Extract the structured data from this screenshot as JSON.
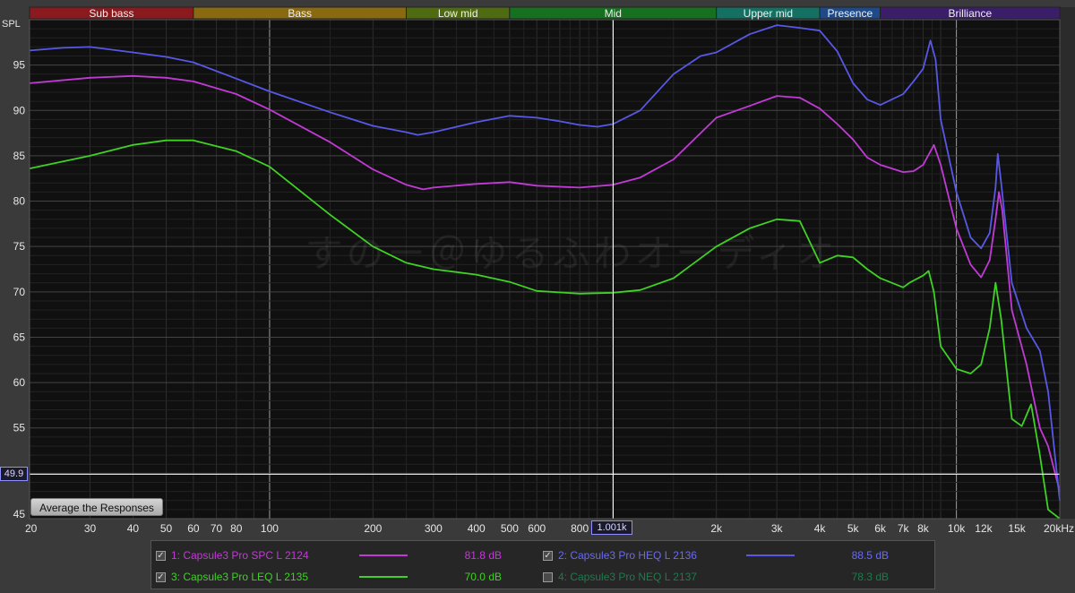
{
  "bands": [
    {
      "label": "Sub bass",
      "from": 20,
      "to": 60,
      "color": "#8a1a1e"
    },
    {
      "label": "Bass",
      "from": 60,
      "to": 250,
      "color": "#8a6a10"
    },
    {
      "label": "Low mid",
      "from": 250,
      "to": 500,
      "color": "#4f6b12"
    },
    {
      "label": "Mid",
      "from": 500,
      "to": 2000,
      "color": "#15701f"
    },
    {
      "label": "Upper mid",
      "from": 2000,
      "to": 4000,
      "color": "#137062"
    },
    {
      "label": "Presence",
      "from": 4000,
      "to": 6000,
      "color": "#1e4a8a"
    },
    {
      "label": "Brilliance",
      "from": 6000,
      "to": 20000,
      "color": "#3b1e6a"
    }
  ],
  "watermark": "すのー＠ゆるふわオーディオ",
  "avg_button_label": "Average the Responses",
  "cursor": {
    "y_readout": "49.9",
    "x_readout": "1.001k",
    "freq": 1001,
    "level": 49.9
  },
  "chart_data": {
    "type": "line",
    "ylabel": "SPL",
    "xlabel": "",
    "x_scale": "log",
    "xlim": [
      20,
      20000
    ],
    "ylim": [
      45,
      100
    ],
    "grid": true,
    "y_ticks": [
      {
        "v": 95,
        "label": "95"
      },
      {
        "v": 90,
        "label": "90"
      },
      {
        "v": 85,
        "label": "85"
      },
      {
        "v": 80,
        "label": "80"
      },
      {
        "v": 75,
        "label": "75"
      },
      {
        "v": 70,
        "label": "70"
      },
      {
        "v": 65,
        "label": "65"
      },
      {
        "v": 60,
        "label": "60"
      },
      {
        "v": 55,
        "label": "55"
      },
      {
        "v": 50,
        "label": "50"
      },
      {
        "v": 45,
        "label": "45"
      }
    ],
    "x_ticks": [
      {
        "v": 20,
        "label": "20"
      },
      {
        "v": 30,
        "label": "30"
      },
      {
        "v": 40,
        "label": "40"
      },
      {
        "v": 50,
        "label": "50"
      },
      {
        "v": 60,
        "label": "60"
      },
      {
        "v": 70,
        "label": "70"
      },
      {
        "v": 80,
        "label": "80"
      },
      {
        "v": 100,
        "label": "100"
      },
      {
        "v": 200,
        "label": "200"
      },
      {
        "v": 300,
        "label": "300"
      },
      {
        "v": 400,
        "label": "400"
      },
      {
        "v": 500,
        "label": "500"
      },
      {
        "v": 600,
        "label": "600"
      },
      {
        "v": 800,
        "label": "800"
      },
      {
        "v": 2000,
        "label": "2k"
      },
      {
        "v": 3000,
        "label": "3k"
      },
      {
        "v": 4000,
        "label": "4k"
      },
      {
        "v": 5000,
        "label": "5k"
      },
      {
        "v": 6000,
        "label": "6k"
      },
      {
        "v": 7000,
        "label": "7k"
      },
      {
        "v": 8000,
        "label": "8k"
      },
      {
        "v": 10000,
        "label": "10k"
      },
      {
        "v": 12000,
        "label": "12k"
      },
      {
        "v": 15000,
        "label": "15k"
      },
      {
        "v": 20000,
        "label": "20kHz"
      }
    ],
    "series": [
      {
        "name": "1: Capsule3 Pro SPC L 2124",
        "color": "#c23ad6",
        "visible": true,
        "level": "81.8 dB",
        "points": [
          [
            20,
            93
          ],
          [
            30,
            93.6
          ],
          [
            40,
            93.8
          ],
          [
            50,
            93.6
          ],
          [
            60,
            93.2
          ],
          [
            80,
            91.8
          ],
          [
            100,
            90.1
          ],
          [
            150,
            86.5
          ],
          [
            200,
            83.5
          ],
          [
            250,
            81.8
          ],
          [
            280,
            81.3
          ],
          [
            300,
            81.5
          ],
          [
            400,
            81.9
          ],
          [
            500,
            82.1
          ],
          [
            600,
            81.7
          ],
          [
            800,
            81.5
          ],
          [
            1000,
            81.8
          ],
          [
            1200,
            82.6
          ],
          [
            1500,
            84.6
          ],
          [
            2000,
            89.2
          ],
          [
            2500,
            90.5
          ],
          [
            3000,
            91.6
          ],
          [
            3500,
            91.4
          ],
          [
            4000,
            90.2
          ],
          [
            4500,
            88.5
          ],
          [
            5000,
            86.8
          ],
          [
            5500,
            84.8
          ],
          [
            6000,
            84
          ],
          [
            7000,
            83.2
          ],
          [
            7500,
            83.3
          ],
          [
            8000,
            84
          ],
          [
            8600,
            86.2
          ],
          [
            9000,
            84
          ],
          [
            10000,
            77
          ],
          [
            11000,
            73
          ],
          [
            11800,
            71.6
          ],
          [
            12500,
            73.5
          ],
          [
            13000,
            78
          ],
          [
            13300,
            81
          ],
          [
            13600,
            79
          ],
          [
            14500,
            68
          ],
          [
            16000,
            62
          ],
          [
            17500,
            55
          ],
          [
            18500,
            53
          ],
          [
            20000,
            48
          ]
        ]
      },
      {
        "name": "2: Capsule3 Pro HEQ L 2136",
        "color": "#5858e6",
        "visible": true,
        "level": "88.5 dB",
        "points": [
          [
            20,
            96.6
          ],
          [
            25,
            96.9
          ],
          [
            30,
            97
          ],
          [
            40,
            96.4
          ],
          [
            50,
            95.9
          ],
          [
            60,
            95.3
          ],
          [
            80,
            93.5
          ],
          [
            100,
            92.1
          ],
          [
            150,
            89.8
          ],
          [
            200,
            88.3
          ],
          [
            250,
            87.6
          ],
          [
            270,
            87.3
          ],
          [
            300,
            87.6
          ],
          [
            400,
            88.7
          ],
          [
            500,
            89.4
          ],
          [
            600,
            89.2
          ],
          [
            700,
            88.8
          ],
          [
            800,
            88.4
          ],
          [
            900,
            88.2
          ],
          [
            1000,
            88.5
          ],
          [
            1200,
            90
          ],
          [
            1500,
            94
          ],
          [
            1800,
            96
          ],
          [
            2000,
            96.4
          ],
          [
            2500,
            98.4
          ],
          [
            3000,
            99.4
          ],
          [
            3500,
            99.1
          ],
          [
            4000,
            98.8
          ],
          [
            4500,
            96.5
          ],
          [
            5000,
            93
          ],
          [
            5500,
            91.2
          ],
          [
            6000,
            90.6
          ],
          [
            7000,
            91.8
          ],
          [
            7500,
            93.2
          ],
          [
            8000,
            94.6
          ],
          [
            8400,
            97.7
          ],
          [
            8700,
            95.6
          ],
          [
            9000,
            89
          ],
          [
            10000,
            81
          ],
          [
            11000,
            76
          ],
          [
            11800,
            74.8
          ],
          [
            12500,
            76.5
          ],
          [
            13000,
            81.5
          ],
          [
            13200,
            85.2
          ],
          [
            13500,
            82
          ],
          [
            14500,
            71
          ],
          [
            16000,
            66
          ],
          [
            17500,
            63.5
          ],
          [
            18500,
            59
          ],
          [
            20000,
            47
          ]
        ]
      },
      {
        "name": "3: Capsule3 Pro LEQ L 2135",
        "color": "#3fd124",
        "visible": true,
        "level": "70.0 dB",
        "points": [
          [
            20,
            83.6
          ],
          [
            30,
            85
          ],
          [
            40,
            86.2
          ],
          [
            50,
            86.7
          ],
          [
            60,
            86.7
          ],
          [
            80,
            85.5
          ],
          [
            100,
            83.8
          ],
          [
            150,
            78.5
          ],
          [
            200,
            75
          ],
          [
            250,
            73.2
          ],
          [
            300,
            72.5
          ],
          [
            400,
            71.9
          ],
          [
            500,
            71.1
          ],
          [
            600,
            70.1
          ],
          [
            800,
            69.8
          ],
          [
            1000,
            69.9
          ],
          [
            1200,
            70.2
          ],
          [
            1500,
            71.5
          ],
          [
            2000,
            75
          ],
          [
            2500,
            77
          ],
          [
            3000,
            78
          ],
          [
            3500,
            77.8
          ],
          [
            4000,
            73.2
          ],
          [
            4500,
            74
          ],
          [
            5000,
            73.8
          ],
          [
            5500,
            72.5
          ],
          [
            6000,
            71.5
          ],
          [
            7000,
            70.5
          ],
          [
            7300,
            71
          ],
          [
            8000,
            71.8
          ],
          [
            8300,
            72.3
          ],
          [
            8600,
            70
          ],
          [
            9000,
            64
          ],
          [
            10000,
            61.5
          ],
          [
            11000,
            61
          ],
          [
            11800,
            62
          ],
          [
            12500,
            66
          ],
          [
            13000,
            71
          ],
          [
            13500,
            67
          ],
          [
            14500,
            56
          ],
          [
            15500,
            55.2
          ],
          [
            16500,
            57.6
          ],
          [
            17500,
            52
          ],
          [
            18500,
            46
          ],
          [
            20000,
            45
          ]
        ]
      },
      {
        "name": "4: Capsule3 Pro NEQ L 2137",
        "color": "#1f7a4c",
        "visible": false,
        "level": "78.3 dB",
        "points": []
      }
    ]
  },
  "legend_colors": {
    "checkbox_checked": "#dddddd"
  }
}
